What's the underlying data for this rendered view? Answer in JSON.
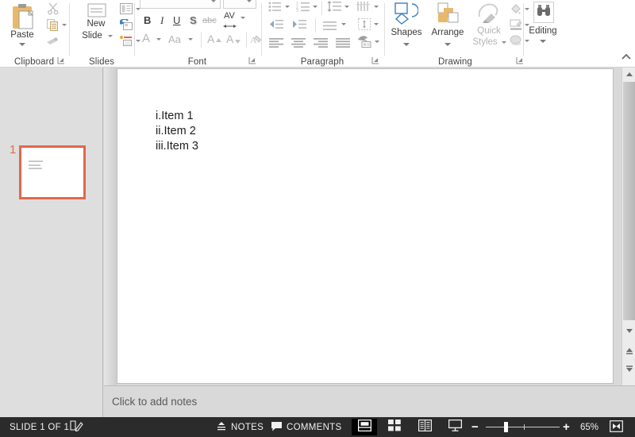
{
  "ribbon": {
    "groups": [
      {
        "label": "Clipboard",
        "has_launcher": true
      },
      {
        "label": "Slides",
        "has_launcher": false
      },
      {
        "label": "Font",
        "has_launcher": true
      },
      {
        "label": "Paragraph",
        "has_launcher": true
      },
      {
        "label": "Drawing",
        "has_launcher": true
      },
      {
        "label": "Editing",
        "has_launcher": false
      }
    ],
    "clipboard": {
      "paste_label": "Paste",
      "cut_icon": "scissors-icon",
      "copy_icon": "copy-icon",
      "format_painter_icon": "format-painter-icon"
    },
    "slides": {
      "new_slide_label": "New\nSlide",
      "new_slide_line1": "New",
      "new_slide_line2": "Slide",
      "layout_icon": "layout-icon",
      "reset_icon": "reset-icon",
      "section_icon": "section-icon"
    },
    "font": {
      "font_name_value": "",
      "font_size_value": "",
      "bold_label": "B",
      "italic_label": "I",
      "underline_label": "U",
      "shadow_label": "S",
      "strikethrough_label": "abc",
      "char_spacing_label": "AV",
      "font_color_label": "A",
      "change_case_label": "Aa",
      "increase_font_label": "A",
      "decrease_font_label": "A",
      "clear_formatting_icon": "clear-formatting-icon"
    },
    "paragraph": {
      "bullets_icon": "bullets-icon",
      "numbering_icon": "numbering-icon",
      "line_spacing_icon": "line-spacing-icon",
      "text_direction_icon": "text-direction-icon",
      "decrease_indent_icon": "decrease-indent-icon",
      "increase_indent_icon": "increase-indent-icon",
      "align_text_icon": "align-text-icon",
      "columns_icon": "columns-icon",
      "align_left_icon": "align-left-icon",
      "align_center_icon": "align-center-icon",
      "align_right_icon": "align-right-icon",
      "justify_icon": "justify-icon",
      "smartart_icon": "convert-to-smartart-icon"
    },
    "drawing": {
      "shapes_label": "Shapes",
      "arrange_label": "Arrange",
      "quick_styles_line1": "Quick",
      "quick_styles_line2": "Styles",
      "shape_fill_icon": "shape-fill-icon",
      "shape_outline_icon": "shape-outline-icon",
      "shape_effects_icon": "shape-effects-icon"
    },
    "editing": {
      "editing_label": "Editing",
      "find_icon": "binoculars-find-icon"
    },
    "collapse_ribbon_icon": "chevron-up-icon"
  },
  "thumbnails": {
    "slides": [
      {
        "number": "1",
        "selected": true
      }
    ]
  },
  "slide": {
    "list_items": [
      "i.Item 1",
      "ii.Item 2",
      "iii.Item 3"
    ]
  },
  "notes": {
    "placeholder": "Click to add notes"
  },
  "scrollbar": {
    "scroll_up_icon": "scroll-up-icon",
    "scroll_down_icon": "scroll-down-icon",
    "previous_slide_icon": "previous-slide-icon",
    "next_slide_icon": "next-slide-icon"
  },
  "statusbar": {
    "slide_indicator": "SLIDE 1 OF 1",
    "language_icon": "spell-check-icon",
    "notes_label": "NOTES",
    "notes_icon": "notes-icon",
    "comments_label": "COMMENTS",
    "comments_icon": "comment-bubble-icon",
    "views": [
      {
        "name": "normal-view",
        "icon": "normal-view-icon",
        "active": true
      },
      {
        "name": "slide-sorter-view",
        "icon": "slide-sorter-icon",
        "active": false
      },
      {
        "name": "reading-view",
        "icon": "reading-view-icon",
        "active": false
      },
      {
        "name": "slide-show-view",
        "icon": "slide-show-icon",
        "active": false
      }
    ],
    "zoom_out_label": "−",
    "zoom_in_label": "+",
    "zoom_level": "65%",
    "fit_slide_icon": "fit-slide-to-window-icon"
  },
  "colors": {
    "accent_orange": "#e2674a",
    "statusbar_bg": "#2b2b2b",
    "workspace_bg": "#d9d9d9",
    "ribbon_bg": "#ffffff"
  }
}
